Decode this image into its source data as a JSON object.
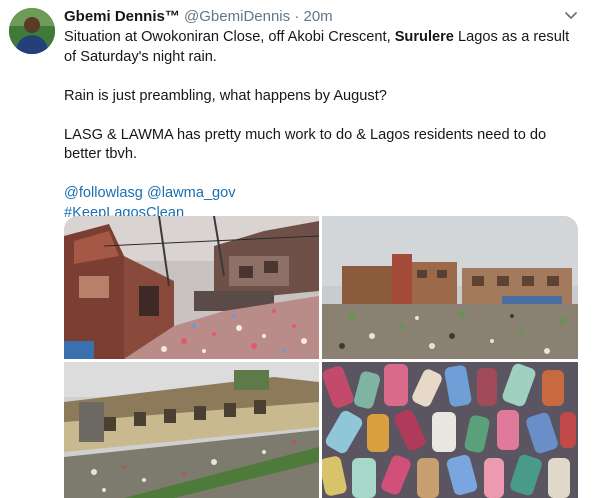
{
  "tweet": {
    "display_name": "Gbemi Dennis™",
    "handle": "@GbemiDennis",
    "separator": "·",
    "time": "20m",
    "line1_prefix": "Situation at Owokoniran Close, off Akobi Crescent, ",
    "line1_bold": "Surulere",
    "line1_suffix": " Lagos as a result of Saturday's night rain.",
    "para2": "Rain is just preambling, what happens by August?",
    "para3": "LASG & LAWMA has pretty much work to do & Lagos residents need to do better tbvh.",
    "mentions": "@followlasg @lawma_gov",
    "hashtag": "#KeepLagosClean"
  },
  "icons": {
    "avatar": "avatar",
    "more": "chevron-down-icon"
  },
  "colors": {
    "link": "#1b6fb0",
    "secondary": "#657786",
    "text": "#14171a"
  }
}
